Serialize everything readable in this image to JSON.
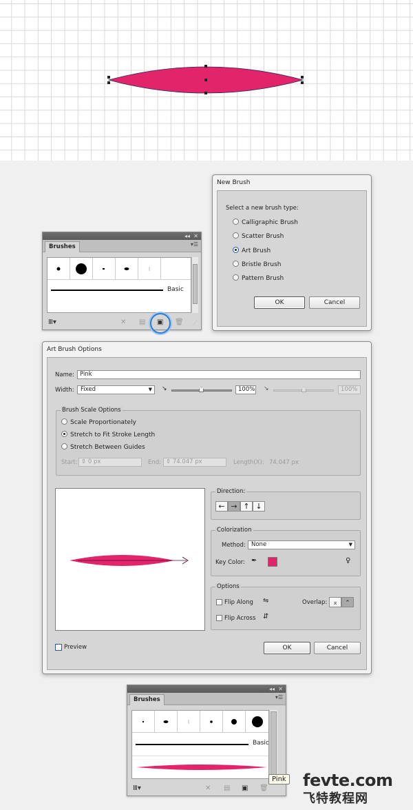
{
  "colors": {
    "accent_pink": "#e2246a",
    "highlight_blue": "#2c7cd1"
  },
  "brushes_panel_top": {
    "tab_label": "Brushes",
    "basic_label": "Basic",
    "icons": [
      "brush-libraries-icon",
      "remove-brush-stroke-icon",
      "brush-options-icon",
      "new-brush-icon",
      "delete-brush-icon"
    ]
  },
  "new_brush_dialog": {
    "title": "New Brush",
    "prompt": "Select a new brush type:",
    "options": [
      "Calligraphic Brush",
      "Scatter Brush",
      "Art Brush",
      "Bristle Brush",
      "Pattern Brush"
    ],
    "selected": "Art Brush",
    "ok_label": "OK",
    "cancel_label": "Cancel"
  },
  "art_brush_options": {
    "title": "Art Brush Options",
    "name_label": "Name:",
    "name_value": "Pink",
    "width_label": "Width:",
    "width_value": "Fixed",
    "width_percent": "100%",
    "width_percent_disabled": "100%",
    "scale_group_title": "Brush Scale Options",
    "scale_options": [
      "Scale Proportionately",
      "Stretch to Fit Stroke Length",
      "Stretch Between Guides"
    ],
    "scale_selected": "Stretch to Fit Stroke Length",
    "start_label": "Start:",
    "start_value": "0 px",
    "end_label": "End:",
    "end_value": "74.047 px",
    "length_label": "Length(X):",
    "length_value": "74.047 px",
    "direction_title": "Direction:",
    "colorization_title": "Colorization",
    "method_label": "Method:",
    "method_value": "None",
    "key_color_label": "Key Color:",
    "options_title": "Options",
    "flip_along_label": "Flip Along",
    "flip_across_label": "Flip Across",
    "overlap_label": "Overlap:",
    "preview_label": "Preview",
    "ok_label": "OK",
    "cancel_label": "Cancel"
  },
  "brushes_panel_bottom": {
    "tab_label": "Brushes",
    "basic_label": "Basic",
    "tooltip": "Pink"
  },
  "watermark": {
    "main": "fevte.com",
    "sub": "飞特教程网"
  }
}
